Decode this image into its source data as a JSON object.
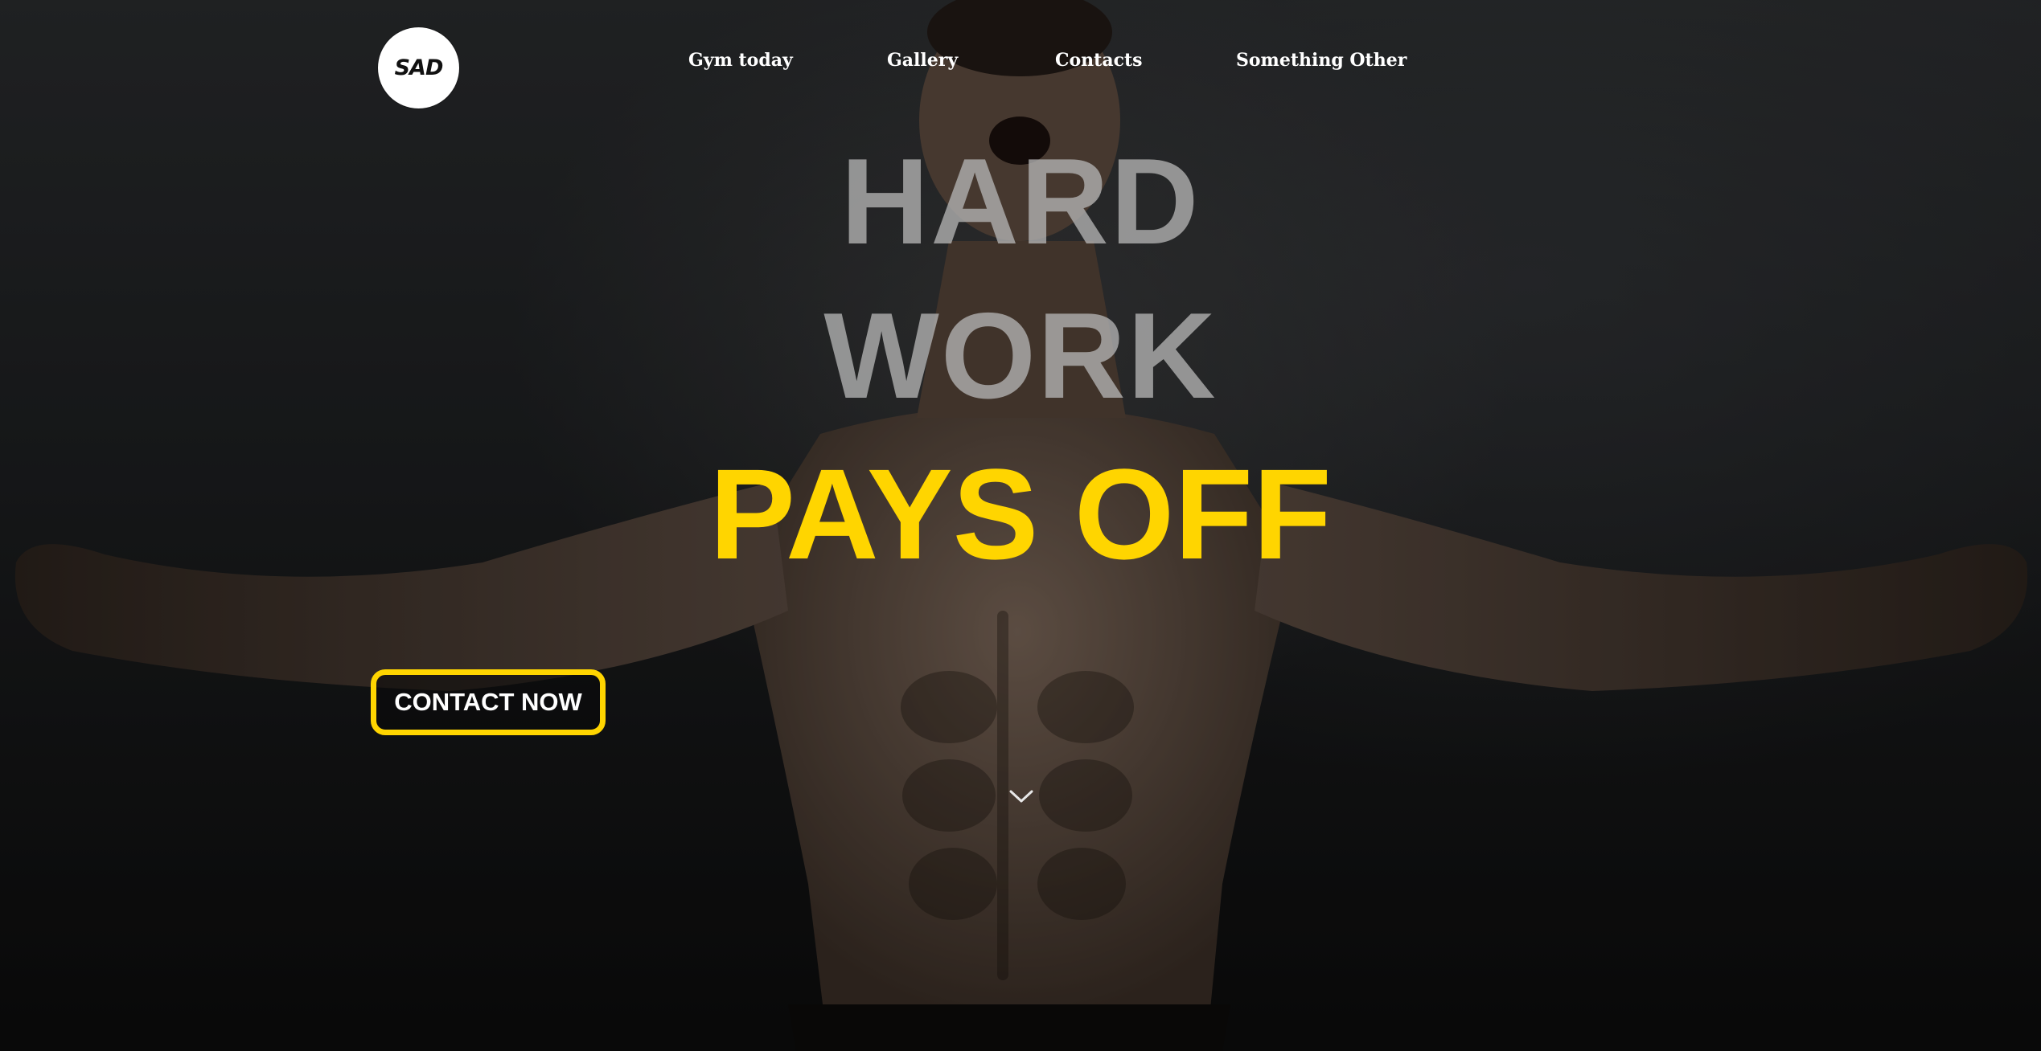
{
  "logo": {
    "text": "SAD",
    "icon": "brand-logo-icon"
  },
  "nav": {
    "items": [
      {
        "label": "Gym today"
      },
      {
        "label": "Gallery"
      },
      {
        "label": "Contacts"
      },
      {
        "label": "Something Other"
      }
    ]
  },
  "hero": {
    "line1": "HARD",
    "line2": "WORK",
    "line3": "PAYS OFF",
    "cta_label": "CONTACT NOW",
    "scroll_icon": "chevron-down-icon"
  },
  "colors": {
    "accent": "#ffd500",
    "headline_muted": "#b4b4b4",
    "nav_text": "#ffffff",
    "background": "#1e2022"
  }
}
